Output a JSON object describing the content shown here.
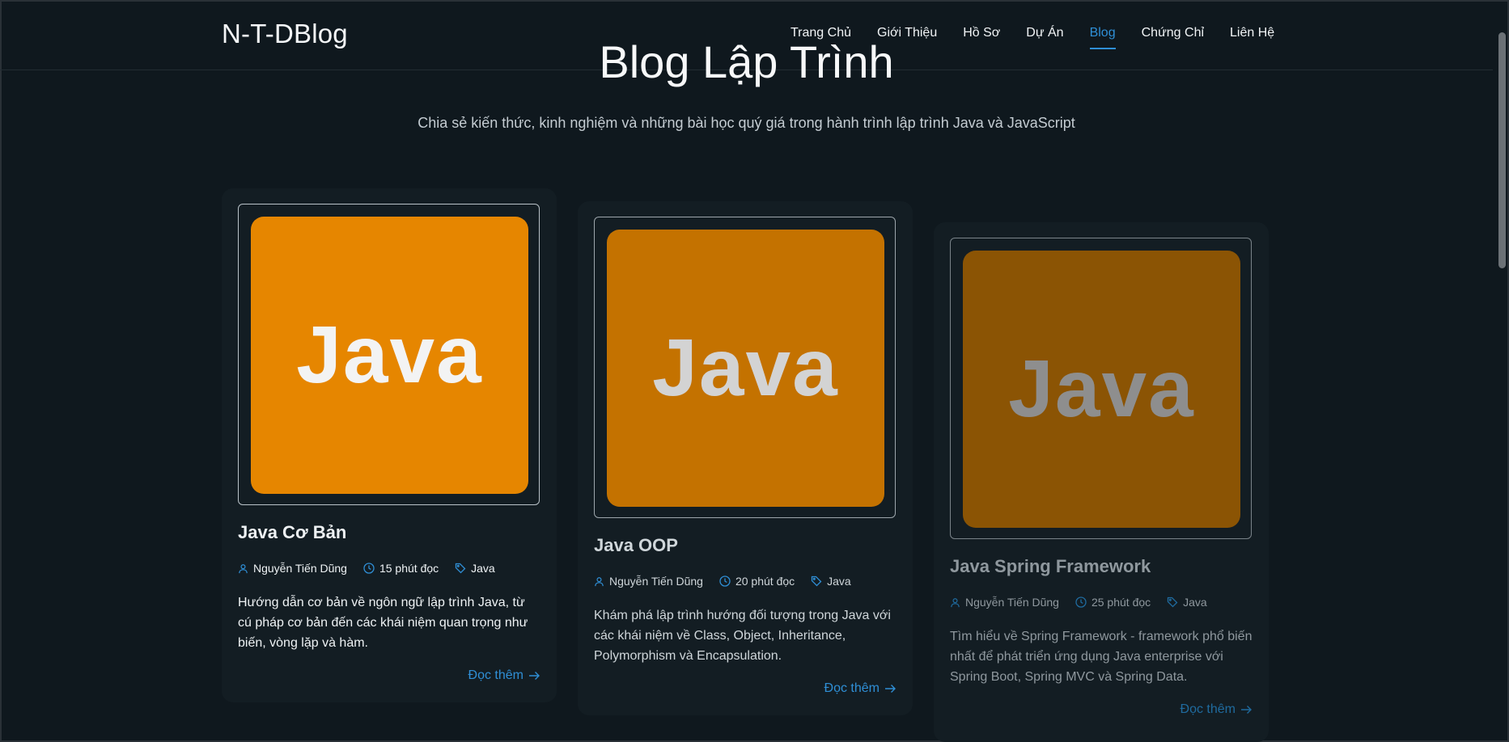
{
  "brand": "N-T-DBlog",
  "nav": [
    "Trang Chủ",
    "Giới Thiệu",
    "Hồ Sơ",
    "Dự Án",
    "Blog",
    "Chứng Chỉ",
    "Liên Hệ"
  ],
  "active_nav": "Blog",
  "hero": {
    "title": "Blog Lập Trình",
    "subtitle": "Chia sẻ kiến thức, kinh nghiệm và những bài học quý giá trong hành trình lập trình Java và JavaScript"
  },
  "posts": [
    {
      "image_text": "Java",
      "title": "Java Cơ Bản",
      "author": "Nguyễn Tiến Dũng",
      "read_time": "15 phút đọc",
      "tag": "Java",
      "excerpt": "Hướng dẫn cơ bản về ngôn ngữ lập trình Java, từ cú pháp cơ bản đến các khái niệm quan trọng như biến, vòng lặp và hàm.",
      "read_more": "Đọc thêm"
    },
    {
      "image_text": "Java",
      "title": "Java OOP",
      "author": "Nguyễn Tiến Dũng",
      "read_time": "20 phút đọc",
      "tag": "Java",
      "excerpt": "Khám phá lập trình hướng đối tượng trong Java với các khái niệm về Class, Object, Inheritance, Polymorphism và Encapsulation.",
      "read_more": "Đọc thêm"
    },
    {
      "image_text": "Java",
      "title": "Java Spring Framework",
      "author": "Nguyễn Tiến Dũng",
      "read_time": "25 phút đọc",
      "tag": "Java",
      "excerpt": "Tìm hiểu về Spring Framework - framework phổ biến nhất để phát triển ứng dụng Java enterprise với Spring Boot, Spring MVC và Spring Data.",
      "read_more": "Đọc thêm"
    }
  ],
  "colors": {
    "accent": "#2f8fd6",
    "java_orange": "#e68600",
    "background": "#0f181e"
  },
  "icons": {
    "author": "user-icon",
    "time": "clock-icon",
    "tag": "tag-icon",
    "arrow": "arrow-right-icon"
  }
}
